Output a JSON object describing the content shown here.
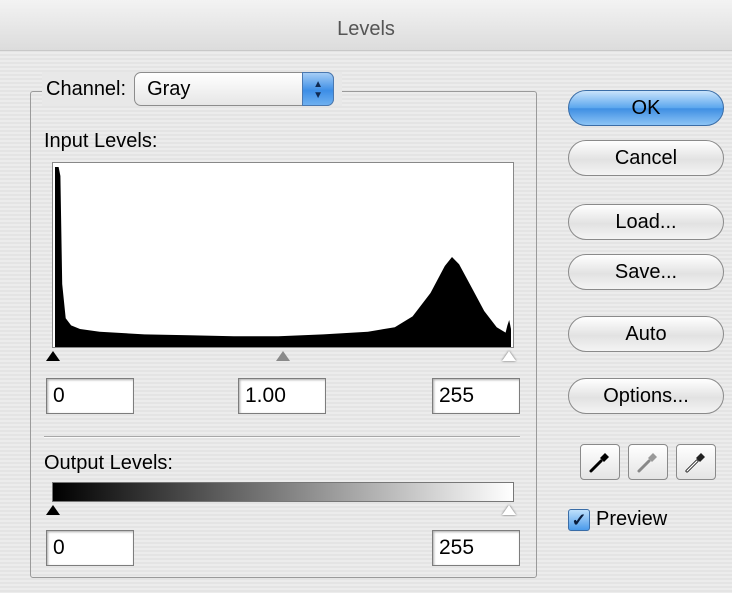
{
  "window": {
    "title": "Levels"
  },
  "channel": {
    "label": "Channel:",
    "selected": "Gray",
    "arrows_glyph": "▲▼"
  },
  "input_levels": {
    "label": "Input Levels:",
    "black_point": "0",
    "midtone": "1.00",
    "white_point": "255",
    "histogram": {
      "type": "area",
      "x_range": [
        0,
        255
      ],
      "profile": [
        [
          0,
          1.0
        ],
        [
          1,
          1.0
        ],
        [
          2,
          1.0
        ],
        [
          3,
          0.95
        ],
        [
          4,
          0.35
        ],
        [
          6,
          0.16
        ],
        [
          9,
          0.12
        ],
        [
          14,
          0.1
        ],
        [
          25,
          0.085
        ],
        [
          50,
          0.07
        ],
        [
          75,
          0.065
        ],
        [
          100,
          0.06
        ],
        [
          125,
          0.06
        ],
        [
          150,
          0.07
        ],
        [
          175,
          0.085
        ],
        [
          190,
          0.11
        ],
        [
          200,
          0.17
        ],
        [
          210,
          0.3
        ],
        [
          218,
          0.45
        ],
        [
          222,
          0.5
        ],
        [
          226,
          0.46
        ],
        [
          233,
          0.33
        ],
        [
          240,
          0.2
        ],
        [
          247,
          0.11
        ],
        [
          252,
          0.08
        ],
        [
          253,
          0.12
        ],
        [
          254,
          0.15
        ],
        [
          255,
          0.1
        ]
      ]
    }
  },
  "output_levels": {
    "label": "Output Levels:",
    "black_point": "0",
    "white_point": "255"
  },
  "buttons": {
    "ok": "OK",
    "cancel": "Cancel",
    "load": "Load...",
    "save": "Save...",
    "auto": "Auto",
    "options": "Options..."
  },
  "eyedroppers": [
    "black-eyedropper-icon",
    "gray-eyedropper-icon",
    "white-eyedropper-icon"
  ],
  "preview": {
    "label": "Preview",
    "checked": true,
    "check_glyph": "✓"
  },
  "colors": {
    "accent": "#3f8fe3",
    "histogram_fill": "#000000"
  }
}
